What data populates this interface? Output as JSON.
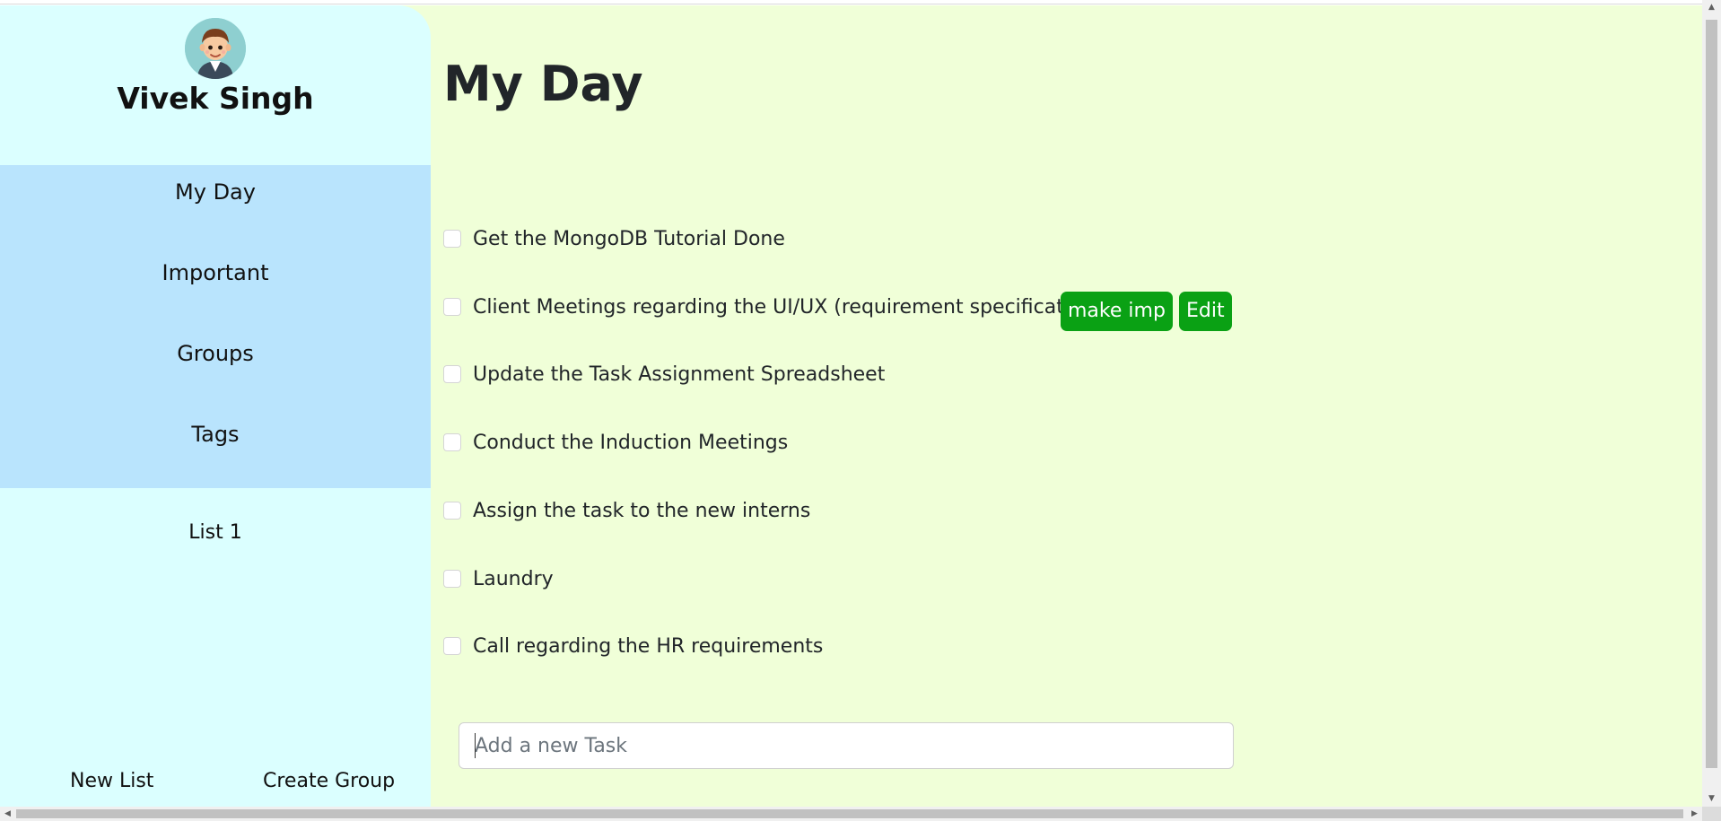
{
  "user": {
    "name": "Vivek Singh"
  },
  "sidebar": {
    "nav": [
      {
        "label": "My Day"
      },
      {
        "label": "Important"
      },
      {
        "label": "Groups"
      },
      {
        "label": "Tags"
      }
    ],
    "lists": [
      {
        "label": "List 1"
      }
    ],
    "footer": {
      "new_list": "New List",
      "create_group": "Create Group"
    }
  },
  "main": {
    "title": "My Day",
    "tasks": [
      {
        "text": "Get the MongoDB Tutorial Done",
        "checked": false
      },
      {
        "text": "Client Meetings regarding the UI/UX (requirement specifications)",
        "checked": false
      },
      {
        "text": "Update the Task Assignment Spreadsheet",
        "checked": false
      },
      {
        "text": "Conduct the Induction Meetings",
        "checked": false
      },
      {
        "text": "Assign the task to the new interns",
        "checked": false
      },
      {
        "text": "Laundry",
        "checked": false
      },
      {
        "text": "Call regarding the HR requirements",
        "checked": false
      }
    ],
    "task_actions": {
      "make_imp": "make imp",
      "edit": "Edit"
    },
    "new_task": {
      "placeholder": "Add a new Task",
      "value": ""
    }
  },
  "colors": {
    "sidebar_bg": "#dbffff",
    "nav_bg": "#b9e4fd",
    "content_bg": "#f0ffd8",
    "button_bg": "#0aa114"
  }
}
